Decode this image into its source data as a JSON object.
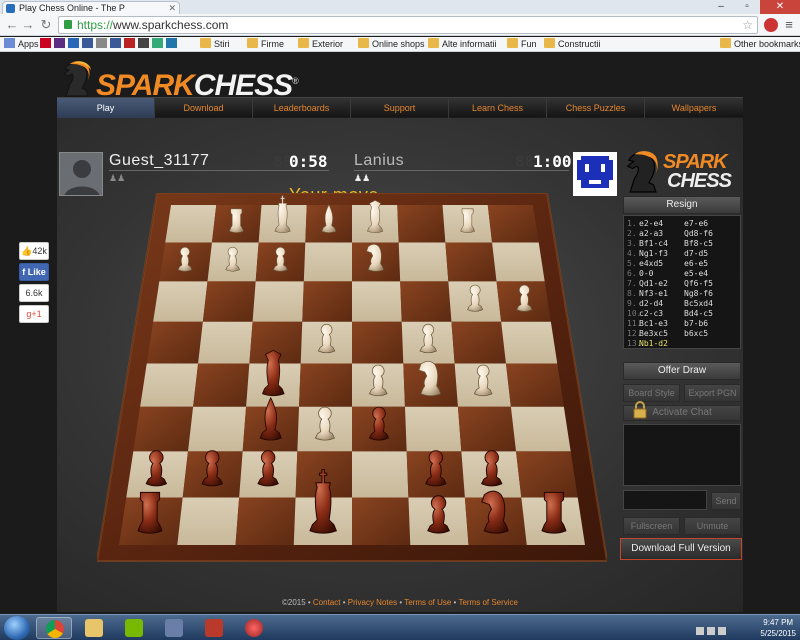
{
  "browser": {
    "tab_title": "Play Chess Online - The P",
    "url_scheme": "https://",
    "url_host": "www.sparkchess.com",
    "bookmarks": [
      "Apps",
      "Stiri",
      "Firme",
      "Exterior",
      "Online shops",
      "Alte informatii",
      "Fun",
      "Constructii",
      "Other bookmarks"
    ]
  },
  "site": {
    "logo_spark": "SPARK",
    "logo_chess": "CHESS",
    "logo_mark": "®",
    "nav": [
      "Play",
      "Download",
      "Leaderboards",
      "Support",
      "Learn Chess",
      "Chess Puzzles",
      "Wallpapers"
    ],
    "active_nav": "Play"
  },
  "game": {
    "player1": {
      "name": "Guest_31177",
      "time": "0:58",
      "time_ghost": "88"
    },
    "player2": {
      "name": "Lanius",
      "time": "1:00",
      "time_ghost": "88"
    },
    "status": "Your move...",
    "panel_logo_spark": "SPARK",
    "panel_logo_chess": "CHESS",
    "resign_label": "Resign",
    "moves": [
      {
        "n": "1.",
        "w": "e2-e4",
        "b": "e7-e6"
      },
      {
        "n": "2.",
        "w": "a2-a3",
        "b": "Qd8-f6"
      },
      {
        "n": "3.",
        "w": "Bf1-c4",
        "b": "Bf8-c5"
      },
      {
        "n": "4.",
        "w": "Ng1-f3",
        "b": "d7-d5"
      },
      {
        "n": "5.",
        "w": "e4xd5",
        "b": "e6-e5"
      },
      {
        "n": "6.",
        "w": "0-0",
        "b": "e5-e4"
      },
      {
        "n": "7.",
        "w": "Qd1-e2",
        "b": "Qf6-f5"
      },
      {
        "n": "8.",
        "w": "Nf3-e1",
        "b": "Ng8-f6"
      },
      {
        "n": "9.",
        "w": "d2-d4",
        "b": "Bc5xd4"
      },
      {
        "n": "10.",
        "w": "c2-c3",
        "b": "Bd4-c5"
      },
      {
        "n": "11.",
        "w": "Bc1-e3",
        "b": "b7-b6"
      },
      {
        "n": "12.",
        "w": "Be3xc5",
        "b": "b6xc5"
      },
      {
        "n": "13.",
        "w": "Nb1-d2",
        "b": ""
      }
    ],
    "offer_draw_label": "Offer Draw",
    "board_style_label": "Board Style",
    "export_pgn_label": "Export PGN",
    "activate_chat_label": "Activate Chat",
    "send_label": "Send",
    "fullscreen_label": "Fullscreen",
    "unmute_label": "Unmute",
    "download_label": "Download Full Version"
  },
  "social": {
    "likes": "42k",
    "like_label": "Like",
    "shares": "6.6k",
    "gplus_label": "g+1"
  },
  "footer": {
    "copyright": "©2015 • ",
    "links": [
      "Contact",
      "Privacy Notes",
      "Terms of Use",
      "Terms of Service"
    ]
  },
  "taskbar": {
    "time": "9:47 PM",
    "date": "5/25/2015"
  },
  "colors": {
    "accent_orange": "#e5862f",
    "status_yellow": "#f0b524",
    "last_move": "#e6e36a"
  }
}
